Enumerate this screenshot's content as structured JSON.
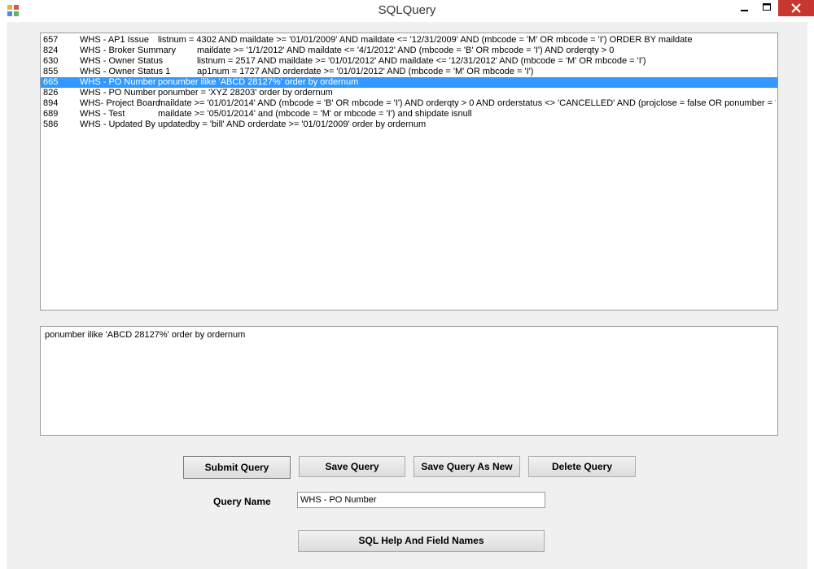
{
  "window": {
    "title": "SQLQuery",
    "minimize_glyph": "–",
    "maximize_glyph": "☐",
    "close_glyph": "✕",
    "app_icon": "sqlquery-app-icon"
  },
  "query_list": {
    "selected_index": 4,
    "rows": [
      {
        "id": "657",
        "name": "WHS - AP1 Issue",
        "query": "listnum = 4302 AND maildate >= '01/01/2009' AND maildate <= '12/31/2009' AND (mbcode = 'M' OR mbcode = 'I') ORDER BY maildate"
      },
      {
        "id": "824",
        "name": "WHS - Broker Summary",
        "query": "maildate >= '1/1/2012' AND maildate <= '4/1/2012' AND (mbcode = 'B' OR mbcode = 'I') AND orderqty > 0"
      },
      {
        "id": "630",
        "name": "WHS - Owner Status",
        "query": "listnum = 2517 AND maildate >= '01/01/2012' AND maildate <= '12/31/2012' AND (mbcode = 'M' OR mbcode = 'I')"
      },
      {
        "id": "855",
        "name": "WHS - Owner Status 1",
        "query": "ap1num = 1727  AND orderdate >= '01/01/2012'  AND (mbcode = 'M' OR mbcode = 'I')"
      },
      {
        "id": "665",
        "name": "WHS - PO Number",
        "query": "ponumber ilike 'ABCD 28127%' order by ordernum"
      },
      {
        "id": "826",
        "name": "WHS - PO Number",
        "query": "ponumber = 'XYZ 28203' order by ordernum"
      },
      {
        "id": "894",
        "name": "WHS- Project Board",
        "query": "maildate >= '01/01/2014' AND (mbcode = 'B' OR mbcode = 'I') AND orderqty > 0 AND orderstatus <> 'CANCELLED' AND (projclose = false OR ponumber = 'BN"
      },
      {
        "id": "689",
        "name": "WHS - Test",
        "query": "maildate >= '05/01/2014' and (mbcode = 'M' or mbcode = 'I') and shipdate isnull"
      },
      {
        "id": "586",
        "name": "WHS - Updated By",
        "query": "updatedby = 'bill' AND orderdate >= '01/01/2009' order by ordernum"
      }
    ]
  },
  "query_text": "ponumber ilike 'ABCD 28127%' order by ordernum",
  "buttons": {
    "submit": "Submit Query",
    "save": "Save Query",
    "save_as_new": "Save Query As New",
    "delete": "Delete Query",
    "sql_help": "SQL Help And Field Names"
  },
  "query_name": {
    "label": "Query Name",
    "value": "WHS - PO Number"
  },
  "colors": {
    "selection": "#3399ff",
    "close_button": "#c7372f",
    "form_background": "#f0f0f0"
  }
}
